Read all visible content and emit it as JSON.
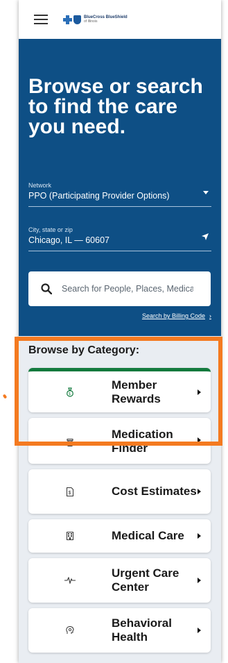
{
  "header": {
    "logo_line1": "BlueCross BlueShield",
    "logo_line2": "of Illinois"
  },
  "hero": {
    "title": "Browse or search to find the care you need."
  },
  "network": {
    "label": "Network",
    "value": "PPO (Participating Provider Options)"
  },
  "location": {
    "label": "City, state or zip",
    "value": "Chicago, IL — 60607"
  },
  "search": {
    "placeholder": "Search for People, Places, Medications"
  },
  "billing_link": "Search by Billing Code",
  "browse": {
    "title": "Browse by Category:",
    "categories": [
      {
        "label": "Member Rewards",
        "icon": "money-bag-icon"
      },
      {
        "label": "Medication Finder",
        "icon": "pill-bottle-icon"
      },
      {
        "label": "Cost Estimates",
        "icon": "dollar-document-icon"
      },
      {
        "label": "Medical Care",
        "icon": "medical-building-icon"
      },
      {
        "label": "Urgent Care Center",
        "icon": "heartbeat-icon"
      },
      {
        "label": "Behavioral Health",
        "icon": "head-profile-icon"
      }
    ]
  },
  "colors": {
    "hero_bg": "#0e4f85",
    "accent_green": "#137a3e",
    "highlight_orange": "#f47a20"
  }
}
